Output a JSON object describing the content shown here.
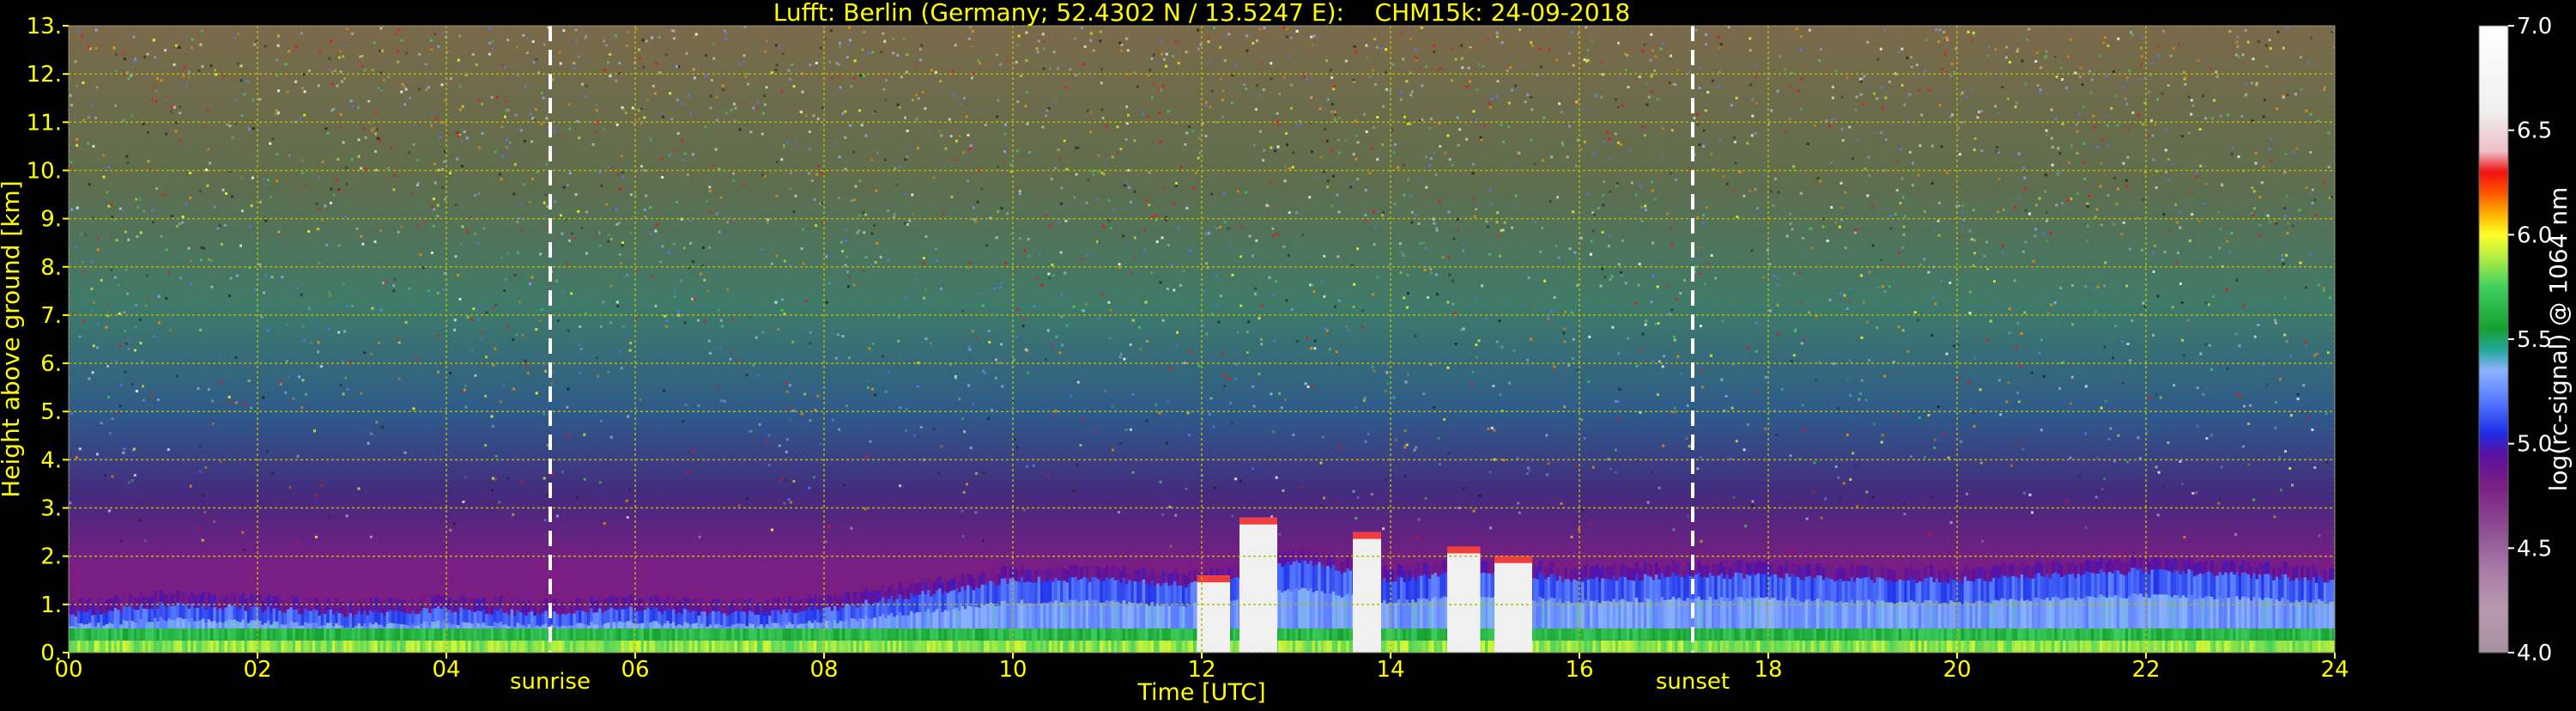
{
  "chart_data": {
    "type": "heatmap",
    "title": "Lufft: Berlin (Germany; 52.4302 N / 13.5247 E):    CHM15k: 24-09-2018",
    "xlabel": "Time [UTC]",
    "ylabel": "Height above ground [km]",
    "xlim": [
      0,
      24
    ],
    "ylim": [
      0,
      13
    ],
    "x_ticks": [
      "00",
      "02",
      "04",
      "06",
      "08",
      "10",
      "12",
      "14",
      "16",
      "18",
      "20",
      "22",
      "24"
    ],
    "y_ticks": [
      "0.",
      "1.",
      "2.",
      "3.",
      "4.",
      "5.",
      "6.",
      "7.",
      "8.",
      "9.",
      "10.",
      "11.",
      "12.",
      "13."
    ],
    "grid": true,
    "annotations": [
      {
        "label": "sunrise",
        "x": 5.1
      },
      {
        "label": "sunset",
        "x": 17.2
      }
    ],
    "colorbar": {
      "label": "log(rc-signal) @ 1064 nm",
      "range": [
        4.0,
        7.0
      ],
      "ticks": [
        "4.0",
        "4.5",
        "5.0",
        "5.5",
        "6.0",
        "6.5",
        "7.0"
      ],
      "stops": [
        {
          "v": 4.0,
          "c": "#a890a0"
        },
        {
          "v": 4.2,
          "c": "#b89ab0"
        },
        {
          "v": 4.4,
          "c": "#a87aa8"
        },
        {
          "v": 4.6,
          "c": "#8c4c92"
        },
        {
          "v": 4.8,
          "c": "#7a1e84"
        },
        {
          "v": 4.95,
          "c": "#5a10a0"
        },
        {
          "v": 5.05,
          "c": "#1e2ee6"
        },
        {
          "v": 5.2,
          "c": "#5478ff"
        },
        {
          "v": 5.35,
          "c": "#8cb2ff"
        },
        {
          "v": 5.45,
          "c": "#22a89a"
        },
        {
          "v": 5.55,
          "c": "#16a030"
        },
        {
          "v": 5.75,
          "c": "#40d060"
        },
        {
          "v": 5.9,
          "c": "#b8f040"
        },
        {
          "v": 6.0,
          "c": "#ffff28"
        },
        {
          "v": 6.1,
          "c": "#ffb000"
        },
        {
          "v": 6.2,
          "c": "#ff5500"
        },
        {
          "v": 6.3,
          "c": "#f01010"
        },
        {
          "v": 6.4,
          "c": "#f0c0c8"
        },
        {
          "v": 6.6,
          "c": "#f0f0f0"
        },
        {
          "v": 7.0,
          "c": "#ffffff"
        }
      ]
    },
    "boundary_layer_top_km": [
      [
        0.0,
        0.8
      ],
      [
        1.0,
        1.0
      ],
      [
        2.0,
        0.9
      ],
      [
        3.0,
        0.8
      ],
      [
        4.0,
        0.9
      ],
      [
        5.0,
        0.8
      ],
      [
        6.0,
        0.9
      ],
      [
        7.0,
        0.8
      ],
      [
        8.0,
        0.9
      ],
      [
        9.0,
        1.2
      ],
      [
        10.0,
        1.5
      ],
      [
        11.0,
        1.5
      ],
      [
        12.0,
        1.4
      ],
      [
        13.0,
        1.9
      ],
      [
        14.0,
        1.5
      ],
      [
        15.0,
        1.7
      ],
      [
        16.0,
        1.5
      ],
      [
        17.0,
        1.6
      ],
      [
        18.0,
        1.6
      ],
      [
        19.0,
        1.5
      ],
      [
        20.0,
        1.5
      ],
      [
        21.0,
        1.6
      ],
      [
        22.0,
        1.7
      ],
      [
        23.0,
        1.6
      ],
      [
        24.0,
        1.5
      ]
    ],
    "cloud_events": [
      {
        "x_start": 11.95,
        "x_end": 12.3,
        "top_km": 1.6
      },
      {
        "x_start": 12.4,
        "x_end": 12.8,
        "top_km": 2.8
      },
      {
        "x_start": 13.6,
        "x_end": 13.9,
        "top_km": 2.5
      },
      {
        "x_start": 14.6,
        "x_end": 14.95,
        "top_km": 2.2
      },
      {
        "x_start": 15.1,
        "x_end": 15.5,
        "top_km": 2.0
      }
    ],
    "colors": {
      "axis_text": "#ffff00",
      "grid": "#b8b800",
      "marker_lines": "#ffffff",
      "background": "#000000"
    }
  }
}
